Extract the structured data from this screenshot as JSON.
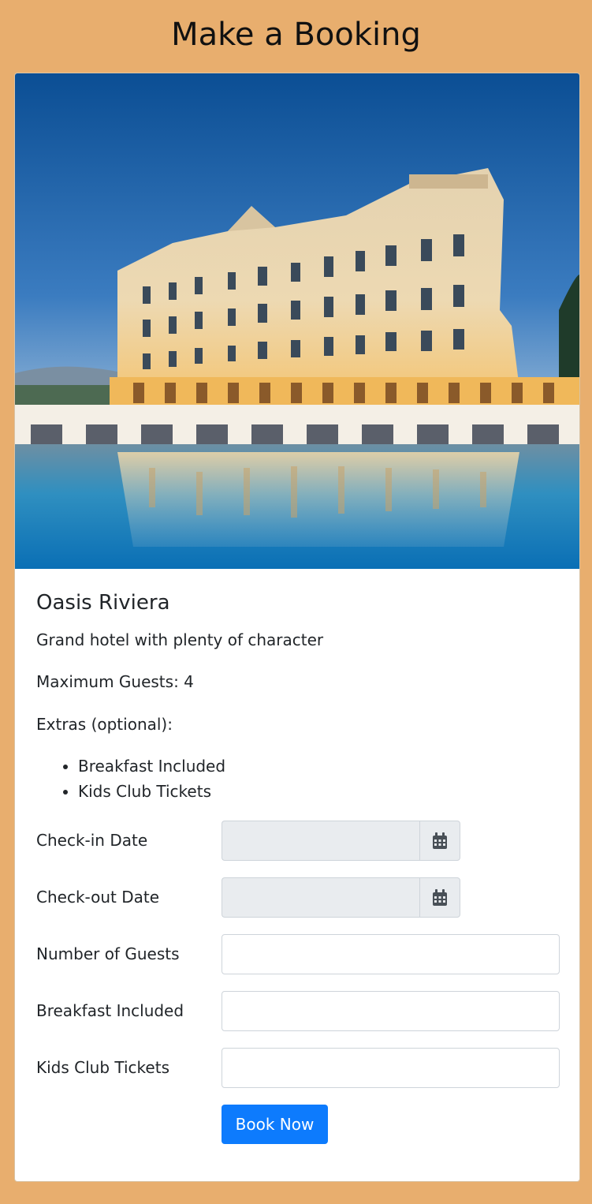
{
  "page": {
    "title": "Make a Booking"
  },
  "hotel": {
    "image_alt": "Oasis Riviera",
    "name": "Oasis Riviera",
    "description": "Grand hotel with plenty of character",
    "max_guests_label": "Maximum Guests: 4",
    "extras_label": "Extras (optional):",
    "extras": [
      "Breakfast Included",
      "Kids Club Tickets"
    ]
  },
  "form": {
    "checkin_label": "Check-in Date",
    "checkin_value": "",
    "checkout_label": "Check-out Date",
    "checkout_value": "",
    "guests_label": "Number of Guests",
    "guests_value": "",
    "breakfast_label": "Breakfast Included",
    "breakfast_value": "",
    "kids_label": "Kids Club Tickets",
    "kids_value": "",
    "calendar_icon": "calendar-icon",
    "submit_label": "Book Now"
  },
  "colors": {
    "page_background": "#e8ae6e",
    "primary_button": "#0d7bfd",
    "disabled_input": "#e9ecef"
  }
}
